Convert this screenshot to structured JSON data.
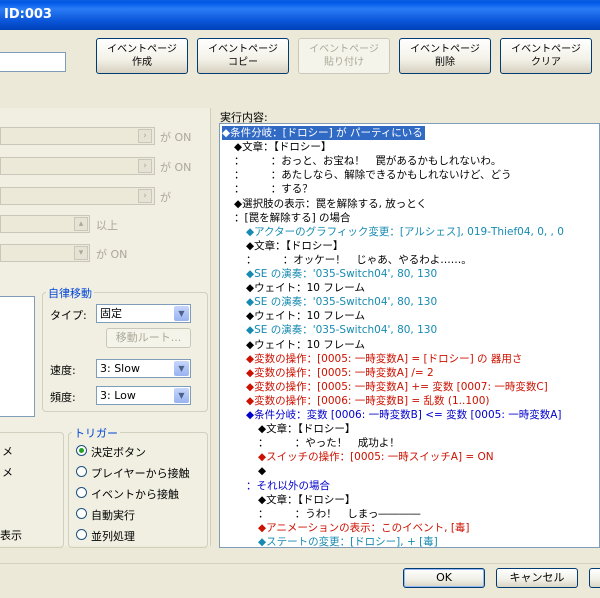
{
  "window": {
    "title": "ID:003"
  },
  "page_buttons": [
    {
      "line1": "イベントページ",
      "line2": "作成",
      "enabled": true
    },
    {
      "line1": "イベントページ",
      "line2": "コピー",
      "enabled": true
    },
    {
      "line1": "イベントページ",
      "line2": "貼り付け",
      "enabled": false
    },
    {
      "line1": "イベントページ",
      "line2": "削除",
      "enabled": true
    },
    {
      "line1": "イベントページ",
      "line2": "クリア",
      "enabled": true
    }
  ],
  "conditions": {
    "suffix_on_1": "が ON",
    "suffix_on_2": "が ON",
    "suffix_ga": "が",
    "suffix_ijou": "以上",
    "suffix_on_3": "が ON"
  },
  "autonomous": {
    "group_title": "自律移動",
    "type_label": "タイプ:",
    "type_value": "固定",
    "move_route_button": "移動ルート...",
    "speed_label": "速度:",
    "speed_value": "3: Slow",
    "freq_label": "頻度:",
    "freq_value": "3: Low"
  },
  "options_partial": {
    "a": "メ",
    "b": "メ",
    "c": "表示"
  },
  "trigger": {
    "group_title": "トリガー",
    "items": [
      {
        "label": "決定ボタン",
        "checked": true
      },
      {
        "label": "プレイヤーから接触",
        "checked": false
      },
      {
        "label": "イベントから接触",
        "checked": false
      },
      {
        "label": "自動実行",
        "checked": false
      },
      {
        "label": "並列処理",
        "checked": false
      }
    ]
  },
  "commands": {
    "header": "実行内容:",
    "lines": [
      {
        "text": "◆条件分岐：[ドロシー] が パーティにいる",
        "color": "blue",
        "indent": 0,
        "selected": true
      },
      {
        "text": "◆文章：【ドロシー】",
        "color": "black",
        "indent": 1
      },
      {
        "text": "：　　　：おっと、お宝ね！　罠があるかもしれないわ。",
        "color": "black",
        "indent": 1
      },
      {
        "text": "：　　　：あたしなら、解除できるかもしれないけど、どう",
        "color": "black",
        "indent": 1
      },
      {
        "text": "：　　　：する？",
        "color": "black",
        "indent": 1
      },
      {
        "text": "◆選択肢の表示：罠を解除する, 放っとく",
        "color": "black",
        "indent": 1
      },
      {
        "text": "：[罠を解除する] の場合",
        "color": "black",
        "indent": 1
      },
      {
        "text": "◆アクターのグラフィック変更：[アルシェス], 019-Thief04, 0, , 0",
        "color": "teal",
        "indent": 2
      },
      {
        "text": "◆文章：【ドロシー】",
        "color": "black",
        "indent": 2
      },
      {
        "text": "：　　　：オッケー！　じゃあ、やるわよ……。",
        "color": "black",
        "indent": 2
      },
      {
        "text": "◆SE の演奏：'035-Switch04', 80, 130",
        "color": "teal",
        "indent": 2
      },
      {
        "text": "◆ウェイト：10 フレーム",
        "color": "black",
        "indent": 2
      },
      {
        "text": "◆SE の演奏：'035-Switch04', 80, 130",
        "color": "teal",
        "indent": 2
      },
      {
        "text": "◆ウェイト：10 フレーム",
        "color": "black",
        "indent": 2
      },
      {
        "text": "◆SE の演奏：'035-Switch04', 80, 130",
        "color": "teal",
        "indent": 2
      },
      {
        "text": "◆ウェイト：10 フレーム",
        "color": "black",
        "indent": 2
      },
      {
        "text": "◆変数の操作：[0005: 一時変数A] = [ドロシー] の 器用さ",
        "color": "red",
        "indent": 2
      },
      {
        "text": "◆変数の操作：[0005: 一時変数A] /= 2",
        "color": "red",
        "indent": 2
      },
      {
        "text": "◆変数の操作：[0005: 一時変数A] += 変数 [0007: 一時変数C]",
        "color": "red",
        "indent": 2
      },
      {
        "text": "◆変数の操作：[0006: 一時変数B] = 乱数 (1..100)",
        "color": "red",
        "indent": 2
      },
      {
        "text": "◆条件分岐：変数 [0006: 一時変数B] <= 変数 [0005: 一時変数A]",
        "color": "blue",
        "indent": 2
      },
      {
        "text": "◆文章：【ドロシー】",
        "color": "black",
        "indent": 3
      },
      {
        "text": "：　　　：やった！　成功よ！",
        "color": "black",
        "indent": 3
      },
      {
        "text": "◆スイッチの操作：[0005: 一時スイッチA] = ON",
        "color": "red",
        "indent": 3
      },
      {
        "text": "◆",
        "color": "black",
        "indent": 3
      },
      {
        "text": "：それ以外の場合",
        "color": "blue",
        "indent": 2
      },
      {
        "text": "◆文章：【ドロシー】",
        "color": "black",
        "indent": 3
      },
      {
        "text": "：　　　：うわ！　しまっ――――",
        "color": "black",
        "indent": 3
      },
      {
        "text": "◆アニメーションの表示：このイベント, [毒]",
        "color": "red",
        "indent": 3
      },
      {
        "text": "◆ステートの変更：[ドロシー], + [毒]",
        "color": "teal",
        "indent": 3
      }
    ]
  },
  "footer": {
    "ok": "OK",
    "cancel": "キャンセル"
  },
  "colors": {
    "title_bar": "#0a55d8",
    "selection": "#316ac5",
    "blue_cmd": "#0000cc",
    "teal_cmd": "#168ab1",
    "red_cmd": "#cc1100"
  }
}
